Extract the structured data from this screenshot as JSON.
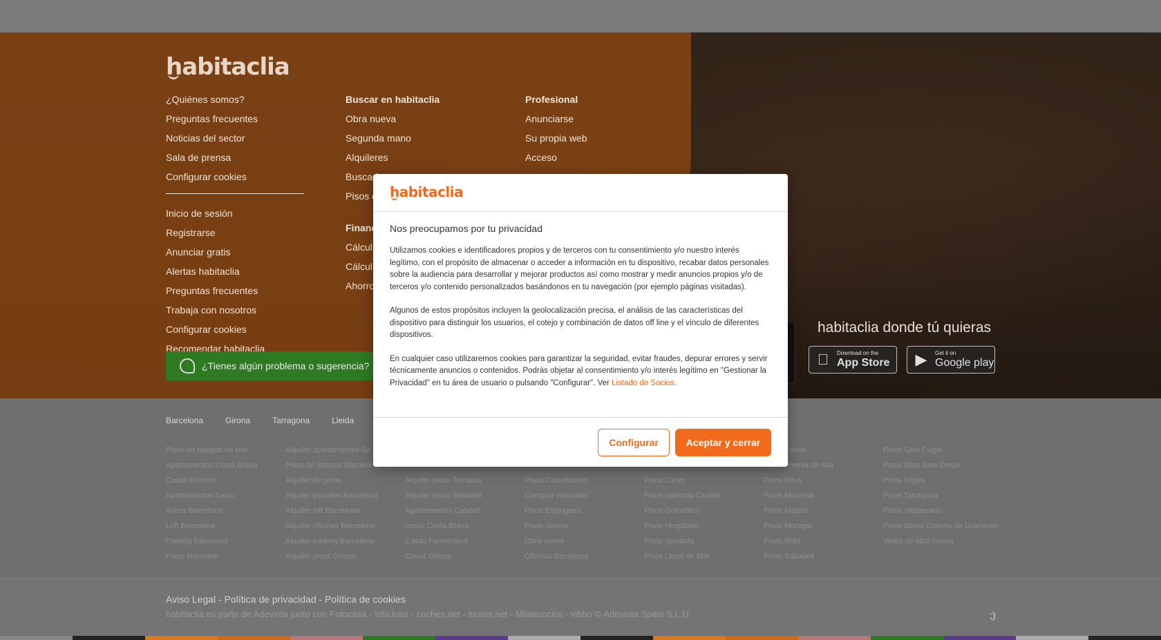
{
  "footer": {
    "logo": "habitaclia",
    "col1_links": [
      "¿Quiénes somos?",
      "Preguntas frecuentes",
      "Noticias del sector",
      "Sala de prensa",
      "Configurar cookies"
    ],
    "col1_links_b": [
      "Inicio de sesión",
      "Registrarse",
      "Anunciar gratis",
      "Alertas habitaclia",
      "Preguntas frecuentes",
      "Trabaja con nosotros",
      "Configurar cookies",
      "Recomendar habitaclia"
    ],
    "col2_heading": "Buscar en habitaclia",
    "col2_links": [
      "Obra nueva",
      "Segunda mano",
      "Alquileres",
      "Buscador",
      "Pisos c"
    ],
    "col2_heading_b": "Financ",
    "col2_links_b": [
      "Cálcul",
      "Cálcul",
      "Ahorro"
    ],
    "col3_heading": "Profesional",
    "col3_links": [
      "Anunciarse",
      "Su propia web",
      "Acceso"
    ],
    "feedback_label": "¿Tienes algún problema o sugerencia?",
    "app_title": "habitaclia donde tú quieras",
    "appstore_small": "Download on the",
    "appstore_big": "App Store",
    "gplay_small": "Get it on",
    "gplay_big": "Google play"
  },
  "cities": {
    "tabs": [
      "Barcelona",
      "Girona",
      "Tarragona",
      "Lleida"
    ],
    "columns": [
      [
        "Pisos en Malgrat de Mar",
        "Apartamentos Costa Brava",
        "Casas Pirineos",
        "Apartamentos Salou",
        "Áticos Barcelona",
        "Loft Barcelona",
        "Parking Barcelona",
        "Pisos Maresme"
      ],
      [
        "Alquiler apartamentos Sa",
        "Pisos de Bancos Barcelona",
        "Alquiler de pisos",
        "Alquiler estudios Barcelona",
        "Alquiler loft Barcelona",
        "Alquiler oficinas Barcelona",
        "Alquiler parking Barcelona",
        "Alquiler pisos Girona"
      ],
      [
        "",
        "",
        "Alquiler pisos Terrassa",
        "Alquiler pisos Sabadell",
        "Apartamentos Calafell",
        "casas Costa Brava",
        "Casas Formentera",
        "Casas Girona"
      ],
      [
        "",
        "",
        "Pisos Castelldefels",
        "Comprar viviendas",
        "Pisos Esplugues",
        "Pisos Girona",
        "Obra nueva",
        "Oficinas Barcelona"
      ],
      [
        "",
        "",
        "Pisos Canet",
        "Pisos Valencia Ciudad",
        "Pisos Granollers",
        "Pisos Hospitalet",
        "Pisos Igualada",
        "Pisos Lloret de Mar"
      ],
      [
        "Pisos Palma",
        "Pisos Premia de Mar",
        "Pisos Reus",
        "Pisos Manresa",
        "Pisos Mataró",
        "Pisos Montgat",
        "Pisos Rubí",
        "Pisos Sabadell"
      ],
      [
        "Pisos Sant Cugat",
        "Pisos Sant Joan Despí",
        "Pisos Sitges",
        "Pisos Tarragona",
        "Pisos Viladecans",
        "Pisos Santa Coloma de Gramenet",
        "Venta de obra nueva",
        ""
      ]
    ]
  },
  "legal": {
    "links": "Aviso Legal - Política de privacidad - Política de cookies",
    "group": "habitaclia es parte de Adevinta junto con   Fotocasa - InfoJobs - coches.net - motos.net - Milanuncios - vibbo © Adevinta Spain S.L.U.",
    "wink": ";)"
  },
  "modal": {
    "logo": "habitaclia",
    "title": "Nos preocupamos por tu privacidad",
    "p1": "Utilizamos cookies e identificadores propios y de terceros con tu consentimiento y/o nuestro interés legítimo, con el propósito de almacenar o acceder a información en tu dispositivo, recabar datos personales sobre la audiencia para desarrollar y mejorar productos así como mostrar y medir anuncios propios y/o de terceros y/o contenido personalizados basándonos en tu navegación (por ejemplo páginas visitadas).",
    "p2": "Algunos de estos propósitos incluyen la geolocalización precisa, el análisis de las características del dispositivo para distinguir los usuarios, el cotejo y combinación de datos off line y el vínculo de diferentes dispositivos.",
    "p3": "En cualquier caso utilizaremos cookies para garantizar la seguridad, evitar fraudes, depurar errores y servir técnicamente anuncios o contenidos. Podrás objetar al consentimiento y/o interés legítimo en \"Gestionar la Privacidad\" en tu área de usuario o pulsando \"Configurar\". Ver ",
    "partners_link": "Listado de Socios.",
    "configure_label": "Configurar",
    "accept_label": "Aceptar y cerrar"
  },
  "colors": {
    "brand": "#f26a1b",
    "feedback_bg": "#2e7a23"
  }
}
